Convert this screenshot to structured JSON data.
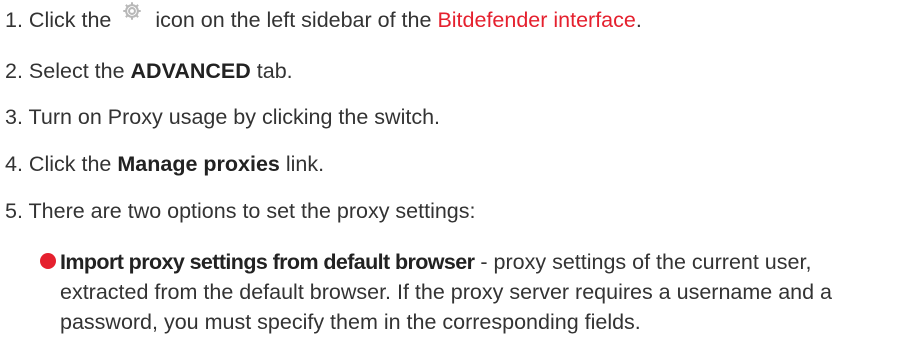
{
  "steps": [
    {
      "num": "1.",
      "before_icon": "Click the",
      "icon": "gear-icon",
      "after_icon": "icon on the left sidebar of the",
      "link": "Bitdefender interface",
      "end": "."
    },
    {
      "num": "2.",
      "before": "Select the",
      "bold": "ADVANCED",
      "after": "tab."
    },
    {
      "num": "3.",
      "text": "Turn on Proxy usage by clicking the switch."
    },
    {
      "num": "4.",
      "before": "Click the",
      "bold": "Manage proxies",
      "after": "link."
    },
    {
      "num": "5.",
      "text": "There are two options to set the proxy settings:"
    }
  ],
  "bullet": {
    "title": "Import proxy settings from default browser",
    "separator": " - ",
    "text": "proxy settings of the current user, extracted from the default browser. If the proxy server requires a username and a password, you must specify them in the corresponding fields."
  },
  "colors": {
    "link": "#e5202e",
    "bullet": "#e5202e",
    "text": "#333333",
    "icon": "#b8b8b8"
  }
}
